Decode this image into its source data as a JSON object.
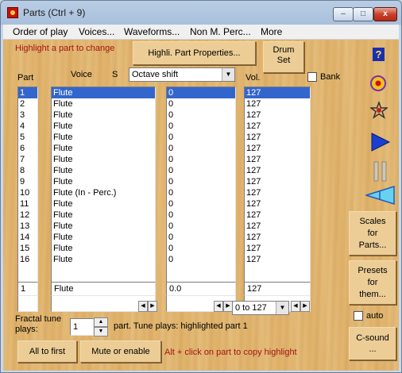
{
  "window": {
    "title": "Parts (Ctrl + 9)",
    "controls": {
      "minimize": "–",
      "maximize": "□",
      "close": "x"
    }
  },
  "menu": [
    "Order of play",
    "Voices...",
    "Waveforms...",
    "Non M. Perc...",
    "More"
  ],
  "header": {
    "instruction": "Highlight a part to change",
    "props_button": "Highli. Part Properties...",
    "drum_set_line1": "Drum",
    "drum_set_line2": "Set",
    "bank_label": "Bank"
  },
  "columns": {
    "part": "Part",
    "voice": "Voice",
    "s": "S",
    "shift_select": "Octave shift",
    "vol": "Vol."
  },
  "parts": [
    "1",
    "2",
    "3",
    "4",
    "5",
    "6",
    "7",
    "8",
    "9",
    "10",
    "11",
    "12",
    "13",
    "14",
    "15",
    "16"
  ],
  "voices": [
    "Flute",
    "Flute",
    "Flute",
    "Flute",
    "Flute",
    "Flute",
    "Flute",
    "Flute",
    "Flute",
    "Flute  (In - Perc.)",
    "Flute",
    "Flute",
    "Flute",
    "Flute",
    "Flute",
    "Flute"
  ],
  "shifts": [
    "0",
    "0",
    "0",
    "0",
    "0",
    "0",
    "0",
    "0",
    "0",
    "0",
    "0",
    "0",
    "0",
    "0",
    "0",
    "0"
  ],
  "volumes": [
    "127",
    "127",
    "127",
    "127",
    "127",
    "127",
    "127",
    "127",
    "127",
    "127",
    "127",
    "127",
    "127",
    "127",
    "127",
    "127"
  ],
  "selected_index": 0,
  "edit": {
    "part": "1",
    "voice": "Flute",
    "shift": "0.0",
    "vol": "127",
    "range": "0 to 127"
  },
  "fractal": {
    "label_line1": "Fractal tune",
    "label_line2": "plays:",
    "value": "1",
    "suffix": "part. Tune plays: highlighted part 1",
    "auto_label": "auto"
  },
  "footer": {
    "all_to_first": "All to first",
    "mute": "Mute or enable",
    "hint": "Alt + click on part to copy highlight"
  },
  "side_buttons": {
    "scales": [
      "Scales",
      "for",
      "Parts..."
    ],
    "presets": [
      "Presets",
      "for",
      "them..."
    ],
    "csound": [
      "C-sound",
      "..."
    ]
  },
  "icons": {
    "help": "help-icon",
    "record": "record-target-icon",
    "star": "star-icon",
    "play": "play-icon",
    "pause": "pause-icon",
    "volume": "volume-wedge-icon"
  },
  "colors": {
    "selection": "#3366cc",
    "wood": "#e3b66e",
    "red_text": "#a31414"
  }
}
